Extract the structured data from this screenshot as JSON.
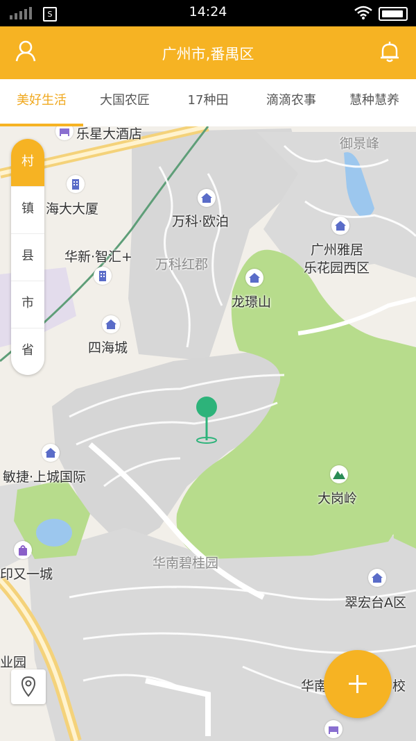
{
  "status_bar": {
    "time": "14:24",
    "sim_label": "S"
  },
  "header": {
    "title": "广州市,番禺区"
  },
  "tabs": [
    {
      "label": "美好生活",
      "active": true
    },
    {
      "label": "大国农匠",
      "active": false
    },
    {
      "label": "17种田",
      "active": false
    },
    {
      "label": "滴滴农事",
      "active": false
    },
    {
      "label": "慧种慧养",
      "active": false
    }
  ],
  "level_selector": [
    {
      "label": "村",
      "active": true
    },
    {
      "label": "镇",
      "active": false
    },
    {
      "label": "县",
      "active": false
    },
    {
      "label": "市",
      "active": false
    },
    {
      "label": "省",
      "active": false
    }
  ],
  "map": {
    "labels": {
      "hotel_top": "乐星大酒店",
      "yujingfeng": "御景峰",
      "haida": "海大大厦",
      "vanke_oubo": "万科·欧泊",
      "yaju_line1": "广州雅居",
      "yaju_line2": "乐花园西区",
      "huaxin": "华新·智汇+",
      "vanke_hongjun": "万科红郡",
      "longpu": "龙璟山",
      "sihai": "四海城",
      "mingjie": "敏捷·上城国际",
      "dagangling": "大岗岭",
      "yinyou": "印又一城",
      "bgy": "华南碧桂园",
      "cuihong": "翠宏台A区",
      "yeyuan": "业园",
      "hua_left": "华南",
      "xiao_right": "校"
    },
    "colors": {
      "green_area": "#b5dd8b",
      "block": "#d6d6d6",
      "water": "#9cc7ee",
      "marker": "#2db37a",
      "road_yellow": "#f4d27a"
    }
  },
  "theme": {
    "accent": "#f6b323"
  }
}
